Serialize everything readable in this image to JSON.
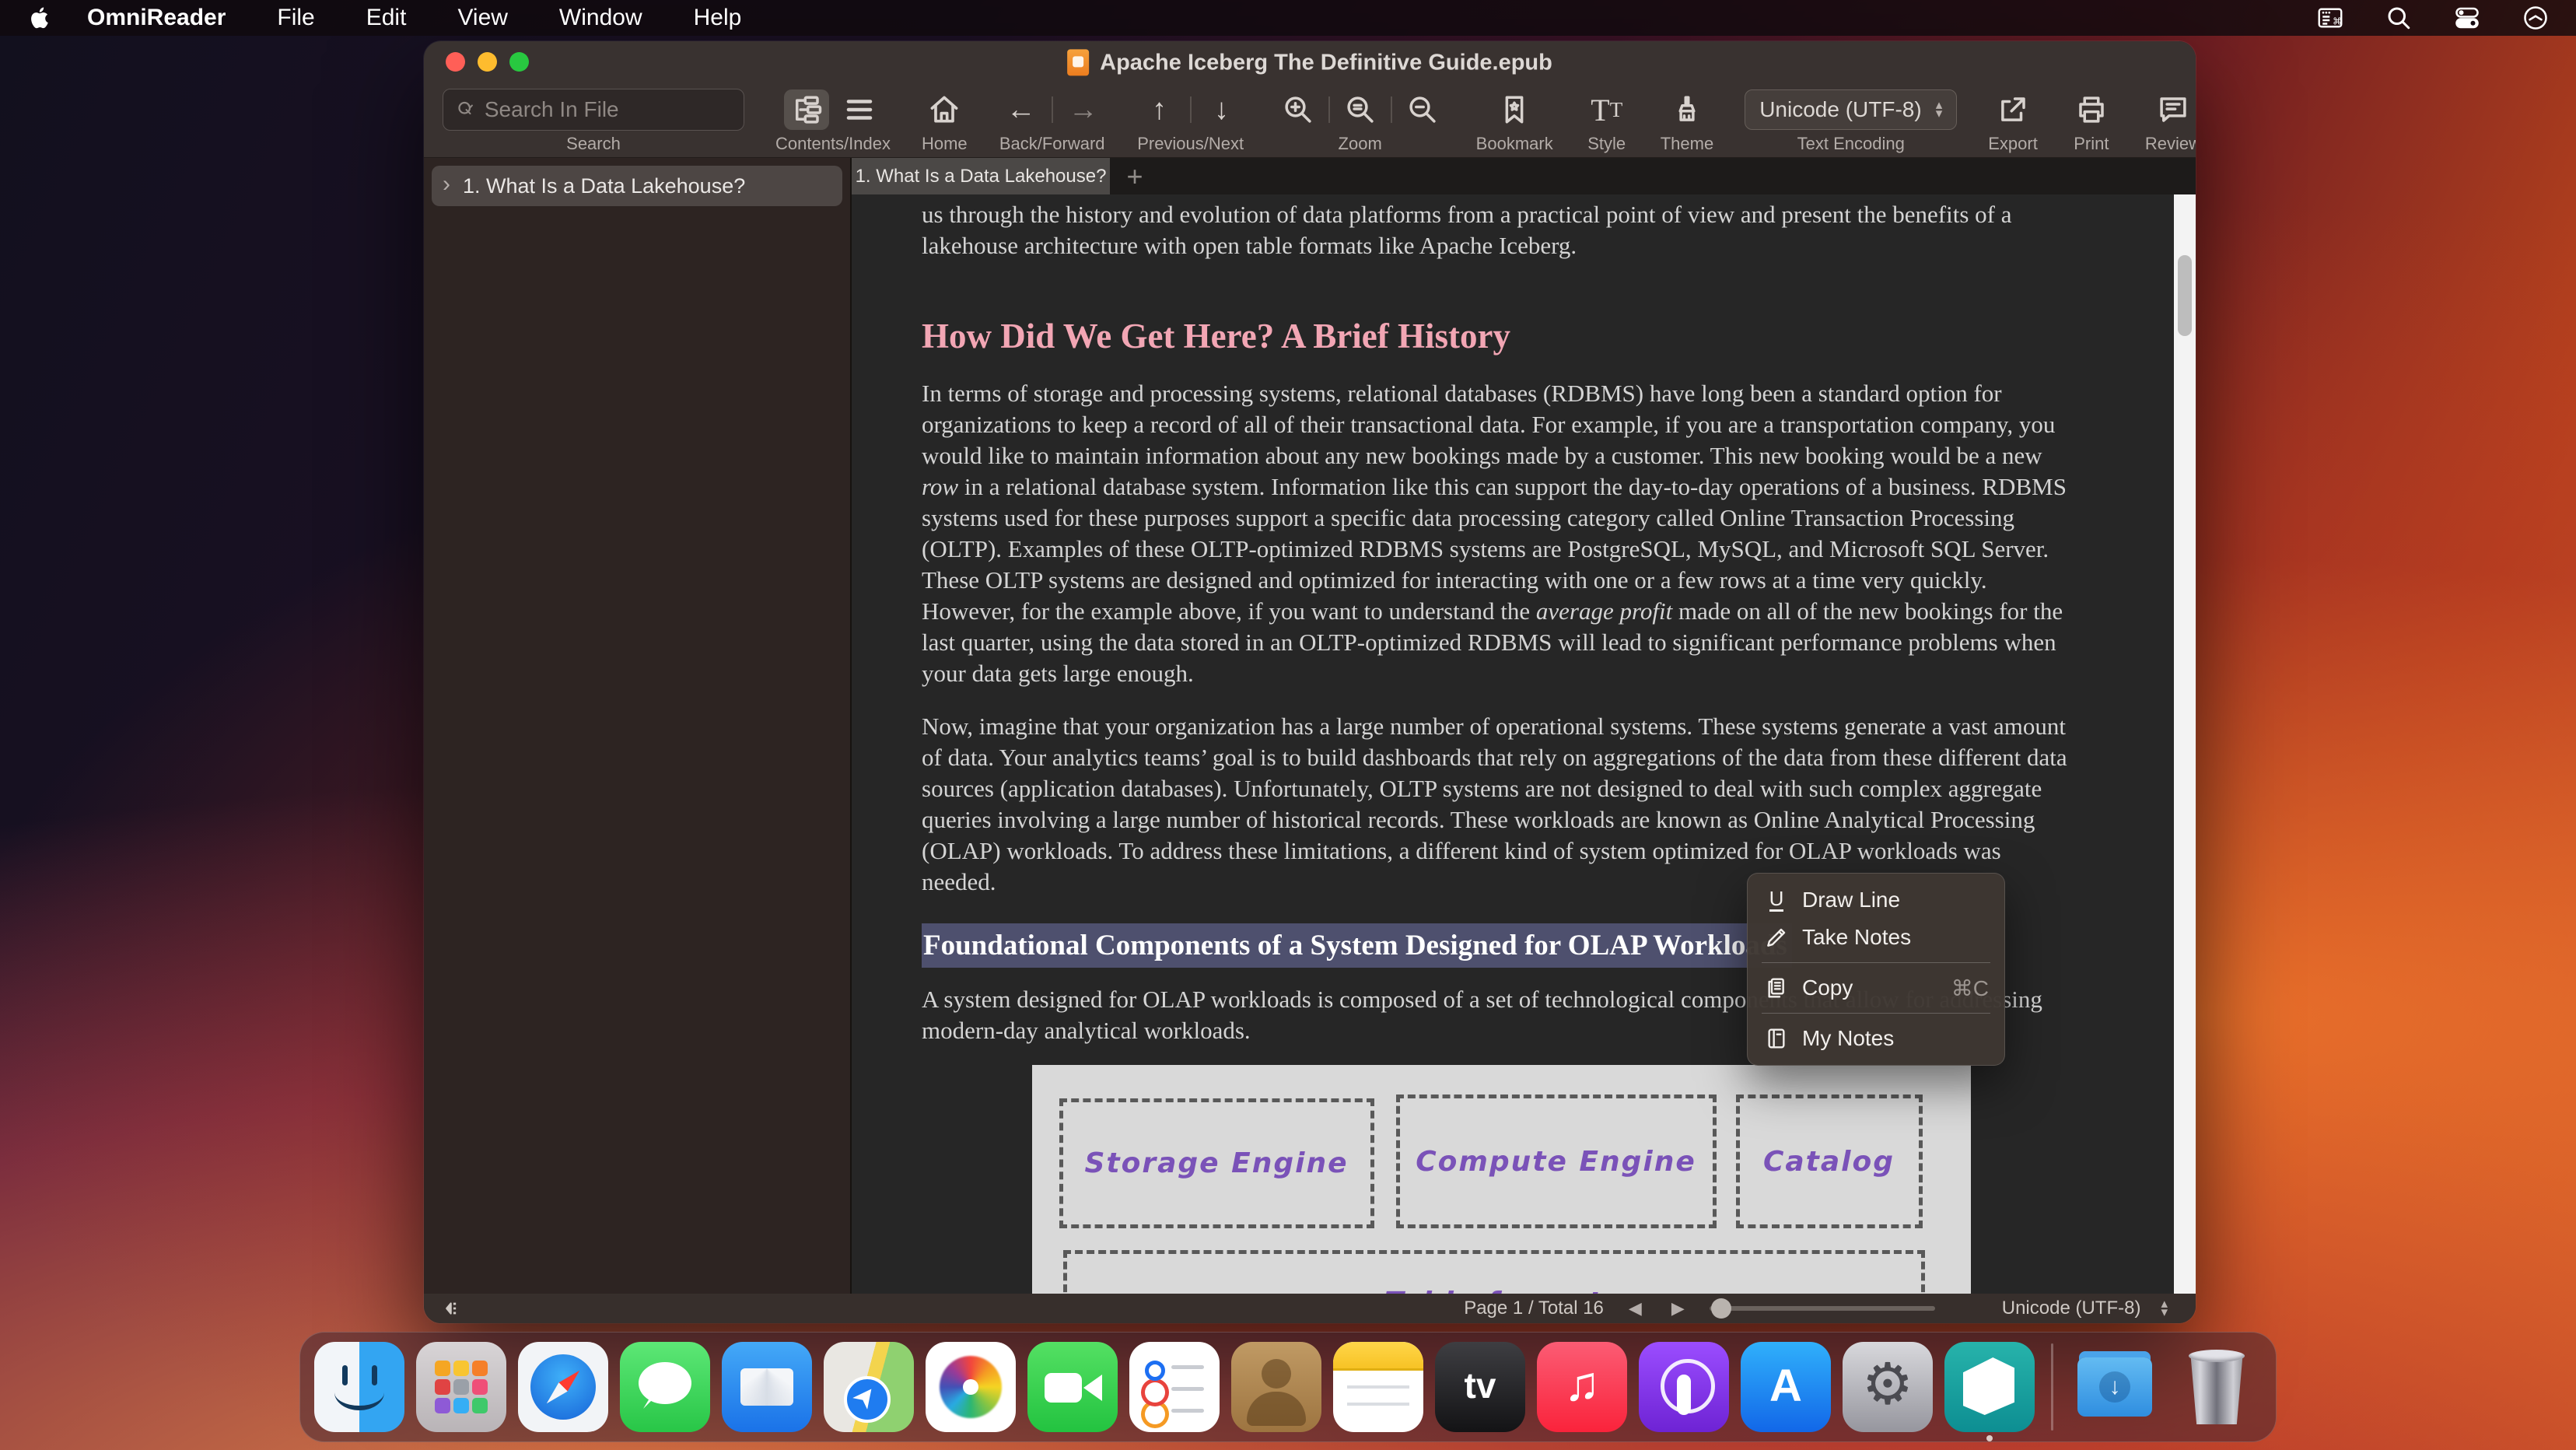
{
  "menu_bar": {
    "app_name": "OmniReader",
    "items": [
      "File",
      "Edit",
      "View",
      "Window",
      "Help"
    ],
    "right_icons": [
      "keyboard-switcher-icon",
      "spotlight-search-icon",
      "control-center-icon",
      "clock-icon"
    ]
  },
  "window": {
    "title": "Apache Iceberg The Definitive Guide.epub",
    "toolbar": {
      "search_placeholder": "Search In File",
      "labels": {
        "search": "Search",
        "contents": "Contents/Index",
        "home": "Home",
        "back_forward": "Back/Forward",
        "prev_next": "Previous/Next",
        "zoom": "Zoom",
        "bookmark": "Bookmark",
        "style": "Style",
        "theme": "Theme",
        "encoding": "Text Encoding",
        "export": "Export",
        "print": "Print",
        "review": "Review"
      },
      "encoding_value": "Unicode  (UTF-8)"
    },
    "tab_bar": {
      "active_tab": "1. What Is a Data Lakehouse?",
      "new_tab_label": "+"
    },
    "sidebar": {
      "items": [
        {
          "label": "1. What Is a Data Lakehouse?",
          "selected": true
        }
      ]
    },
    "content": {
      "blocks": [
        {
          "type": "p",
          "first": true,
          "segments": [
            {
              "t": "us through the history and evolution of data platforms from a practical point of view and present the benefits of a lakehouse architecture with open table formats like Apache Iceberg."
            }
          ]
        },
        {
          "type": "h2",
          "text": "How Did We Get Here? A Brief History"
        },
        {
          "type": "p",
          "segments": [
            {
              "t": "In terms of storage and processing systems, relational databases (RDBMS) have long been a standard option for organizations to keep a record of all of their transactional data. For example, if you are a transportation company, you would like to maintain information about any new bookings made by a customer. This new booking would be a new "
            },
            {
              "t": "row",
              "i": true
            },
            {
              "t": " in a relational database system. Information like this can support the day-to-day operations of a business. RDBMS systems used for these purposes support a specific data processing category called Online Transaction Processing (OLTP). Examples of these OLTP-optimized RDBMS systems are PostgreSQL, MySQL, and Microsoft SQL Server. These OLTP systems are designed and optimized for interacting with one or a few rows at a time very quickly. However, for the example above, if you want to understand the "
            },
            {
              "t": "average profit",
              "i": true
            },
            {
              "t": " made on all of the new bookings for the last quarter, using the data stored in an OLTP-optimized RDBMS will lead to significant performance problems when your data gets large enough."
            }
          ]
        },
        {
          "type": "p",
          "segments": [
            {
              "t": "Now, imagine that your organization has a large number of operational systems. These systems generate a vast amount of data. Your analytics teams’ goal is to build dashboards that rely on aggregations of the data from these different data sources (application databases). Unfortunately, OLTP systems are not designed to deal with such complex aggregate queries involving a large number of historical records. These workloads are known as Online Analytical Processing (OLAP) workloads. To address these limitations, a different kind of system optimized for OLAP workloads was needed."
            }
          ]
        },
        {
          "type": "h3",
          "selected": true,
          "text": "Foundational Components of a System Designed for OLAP Workloads"
        },
        {
          "type": "p",
          "segments": [
            {
              "t": "A system designed for OLAP workloads is composed of a set of technological components that allow for addressing modern-day analytical workloads."
            }
          ]
        }
      ],
      "diagram": {
        "boxes": {
          "storage": "Storage Engine",
          "compute": "Compute Engine",
          "catalog": "Catalog",
          "table": "Table format"
        },
        "background": "#d9d9d9",
        "dash_color": "#595959",
        "text_color": "#7a52b8"
      }
    },
    "context_menu": {
      "items": [
        {
          "label": "Draw Line",
          "icon": "underline-icon"
        },
        {
          "label": "Take Notes",
          "icon": "pencil-icon"
        },
        {
          "divider": true
        },
        {
          "label": "Copy",
          "icon": "copy-icon",
          "shortcut": "⌘C"
        },
        {
          "divider": true
        },
        {
          "label": "My Notes",
          "icon": "notebook-icon"
        }
      ]
    },
    "status_bar": {
      "page_label": "Page 1 / Total 16",
      "prev_arrow": "◀",
      "next_arrow": "▶",
      "encoding": "Unicode  (UTF-8)"
    }
  },
  "dock": {
    "apps": [
      {
        "id": "finder",
        "label": "Finder",
        "running": true
      },
      {
        "id": "launchpad",
        "label": "Launchpad"
      },
      {
        "id": "safari",
        "label": "Safari"
      },
      {
        "id": "messages",
        "label": "Messages"
      },
      {
        "id": "mail",
        "label": "Mail"
      },
      {
        "id": "maps",
        "label": "Maps"
      },
      {
        "id": "photos",
        "label": "Photos"
      },
      {
        "id": "facetime",
        "label": "FaceTime"
      },
      {
        "id": "reminders",
        "label": "Reminders"
      },
      {
        "id": "contacts",
        "label": "Contacts"
      },
      {
        "id": "notes",
        "label": "Notes"
      },
      {
        "id": "tv",
        "label": "TV"
      },
      {
        "id": "music",
        "label": "Music"
      },
      {
        "id": "podcasts",
        "label": "Podcasts"
      },
      {
        "id": "appstore",
        "label": "App Store"
      },
      {
        "id": "settings",
        "label": "System Settings"
      },
      {
        "id": "omnireader",
        "label": "OmniReader",
        "running": true
      },
      {
        "id": "separator"
      },
      {
        "id": "downloads",
        "label": "Downloads"
      },
      {
        "id": "trash",
        "label": "Trash"
      }
    ]
  },
  "colors": {
    "heading_pink": "#f2a6b4",
    "selection_highlight": "#8084c8",
    "diagram_purple": "#7a52b8",
    "traffic_red": "#ff5f57",
    "traffic_yellow": "#febc2e",
    "traffic_green": "#28c840",
    "toolbar_bg": "#393230",
    "sidebar_bg": "#2d2422",
    "content_bg": "#262626"
  }
}
